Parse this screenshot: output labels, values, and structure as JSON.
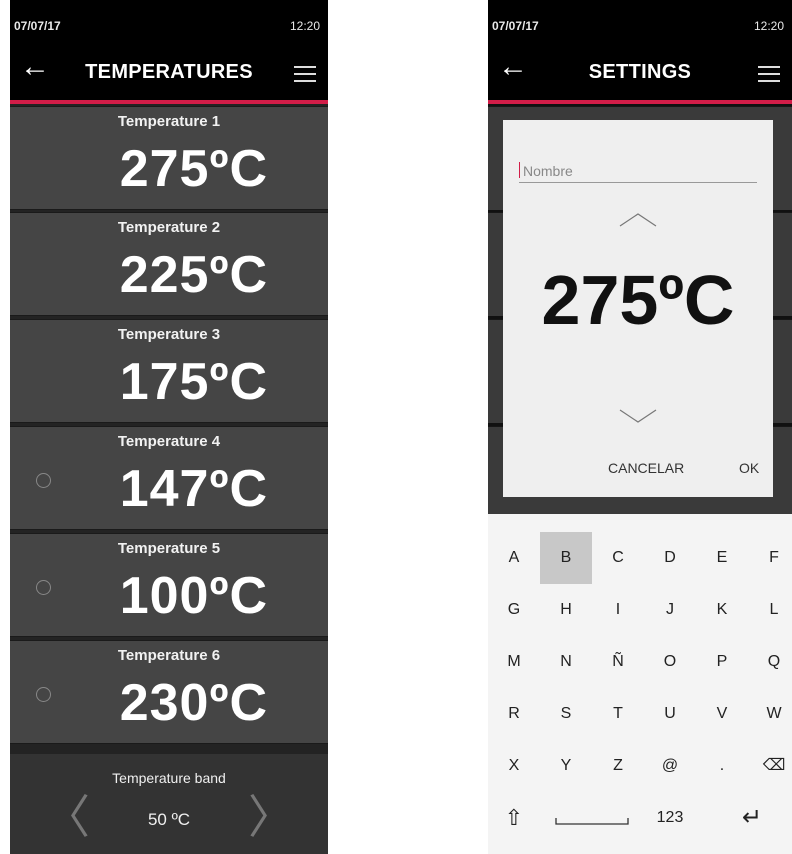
{
  "left_screen": {
    "status": {
      "date": "07/07/17",
      "time": "12:20"
    },
    "appbar": {
      "title": "TEMPERATURES"
    },
    "temperatures": [
      {
        "label": "Temperature 1",
        "value": "275ºC",
        "radio": false
      },
      {
        "label": "Temperature 2",
        "value": "225ºC",
        "radio": false
      },
      {
        "label": "Temperature 3",
        "value": "175ºC",
        "radio": false
      },
      {
        "label": "Temperature 4",
        "value": "147ºC",
        "radio": true
      },
      {
        "label": "Temperature 5",
        "value": "100ºC",
        "radio": true
      },
      {
        "label": "Temperature 6",
        "value": "230ºC",
        "radio": true
      }
    ],
    "band": {
      "label": "Temperature band",
      "value": "50 ºC"
    }
  },
  "right_screen": {
    "status": {
      "date": "07/07/17",
      "time": "12:20"
    },
    "appbar": {
      "title": "SETTINGS"
    },
    "dialog": {
      "name_placeholder": "Nombre",
      "value": "275ºC",
      "cancel_label": "CANCELAR",
      "ok_label": "OK"
    },
    "keyboard": {
      "rows": [
        [
          "A",
          "B",
          "C",
          "D",
          "E",
          "F"
        ],
        [
          "G",
          "H",
          "I",
          "J",
          "K",
          "L"
        ],
        [
          "M",
          "N",
          "Ñ",
          "O",
          "P",
          "Q"
        ],
        [
          "R",
          "S",
          "T",
          "U",
          "V",
          "W"
        ],
        [
          "X",
          "Y",
          "Z",
          "@",
          ".",
          "⌫"
        ]
      ],
      "pressed_key": "B",
      "bottom_row": {
        "shift": "⇧",
        "space": "space",
        "numbers": "123",
        "enter": "↵"
      }
    }
  },
  "colors": {
    "accent": "#d21d48",
    "card": "#454545",
    "dialog": "#efefef",
    "keyboard": "#f4f4f4"
  }
}
